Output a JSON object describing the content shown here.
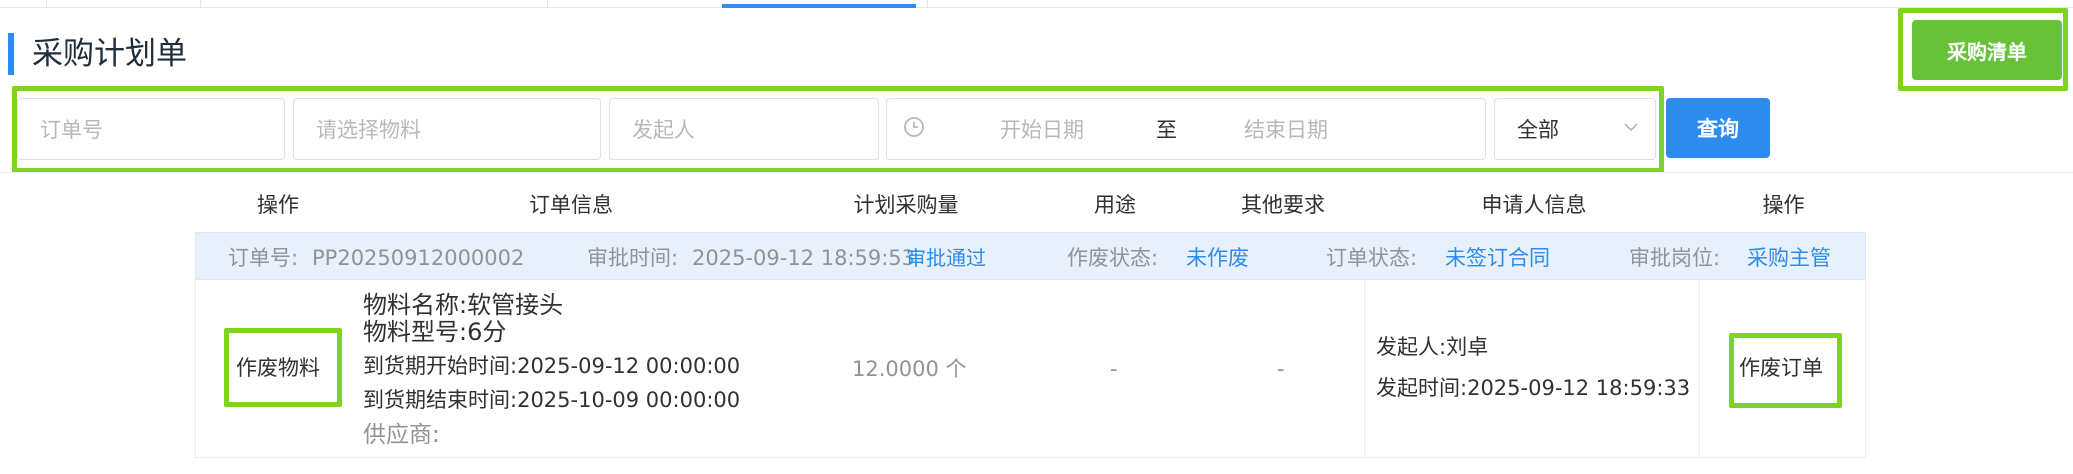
{
  "header": {
    "title": "采购计划单",
    "purchase_list_button": "采购清单"
  },
  "filters": {
    "order_no_placeholder": "订单号",
    "material_placeholder": "请选择物料",
    "initiator_placeholder": "发起人",
    "start_date_placeholder": "开始日期",
    "date_separator": "至",
    "end_date_placeholder": "结束日期",
    "status_select_value": "全部",
    "query_button": "查询"
  },
  "table": {
    "columns": [
      "操作",
      "订单信息",
      "计划采购量",
      "用途",
      "其他要求",
      "申请人信息",
      "操作"
    ],
    "order": {
      "order_no_label": "订单号:",
      "order_no": "PP20250912000002",
      "approve_time_label": "审批时间:",
      "approve_time": "2025-09-12 18:59:53",
      "approve_status": "审批通过",
      "void_status_label": "作废状态:",
      "void_status": "未作废",
      "order_status_label": "订单状态:",
      "order_status": "未签订合同",
      "approve_post_label": "审批岗位:",
      "approve_post": "采购主管"
    },
    "row": {
      "void_material_action": "作废物料",
      "material_name_label": "物料名称:",
      "material_name": "软管接头",
      "material_model_label": "物料型号:",
      "material_model": "6分",
      "delivery_start_label": "到货期开始时间:",
      "delivery_start": "2025-09-12 00:00:00",
      "delivery_end_label": "到货期结束时间:",
      "delivery_end": "2025-10-09 00:00:00",
      "supplier_label": "供应商:",
      "planned_qty": "12.0000 个",
      "usage": "-",
      "other_requirements": "-",
      "initiator_label": "发起人:",
      "initiator": "刘卓",
      "initiate_time_label": "发起时间:",
      "initiate_time": "2025-09-12 18:59:33",
      "void_order_action": "作废订单"
    }
  },
  "colors": {
    "primary": "#2d8cf0",
    "success": "#67c23a",
    "highlight": "#7ed321"
  }
}
